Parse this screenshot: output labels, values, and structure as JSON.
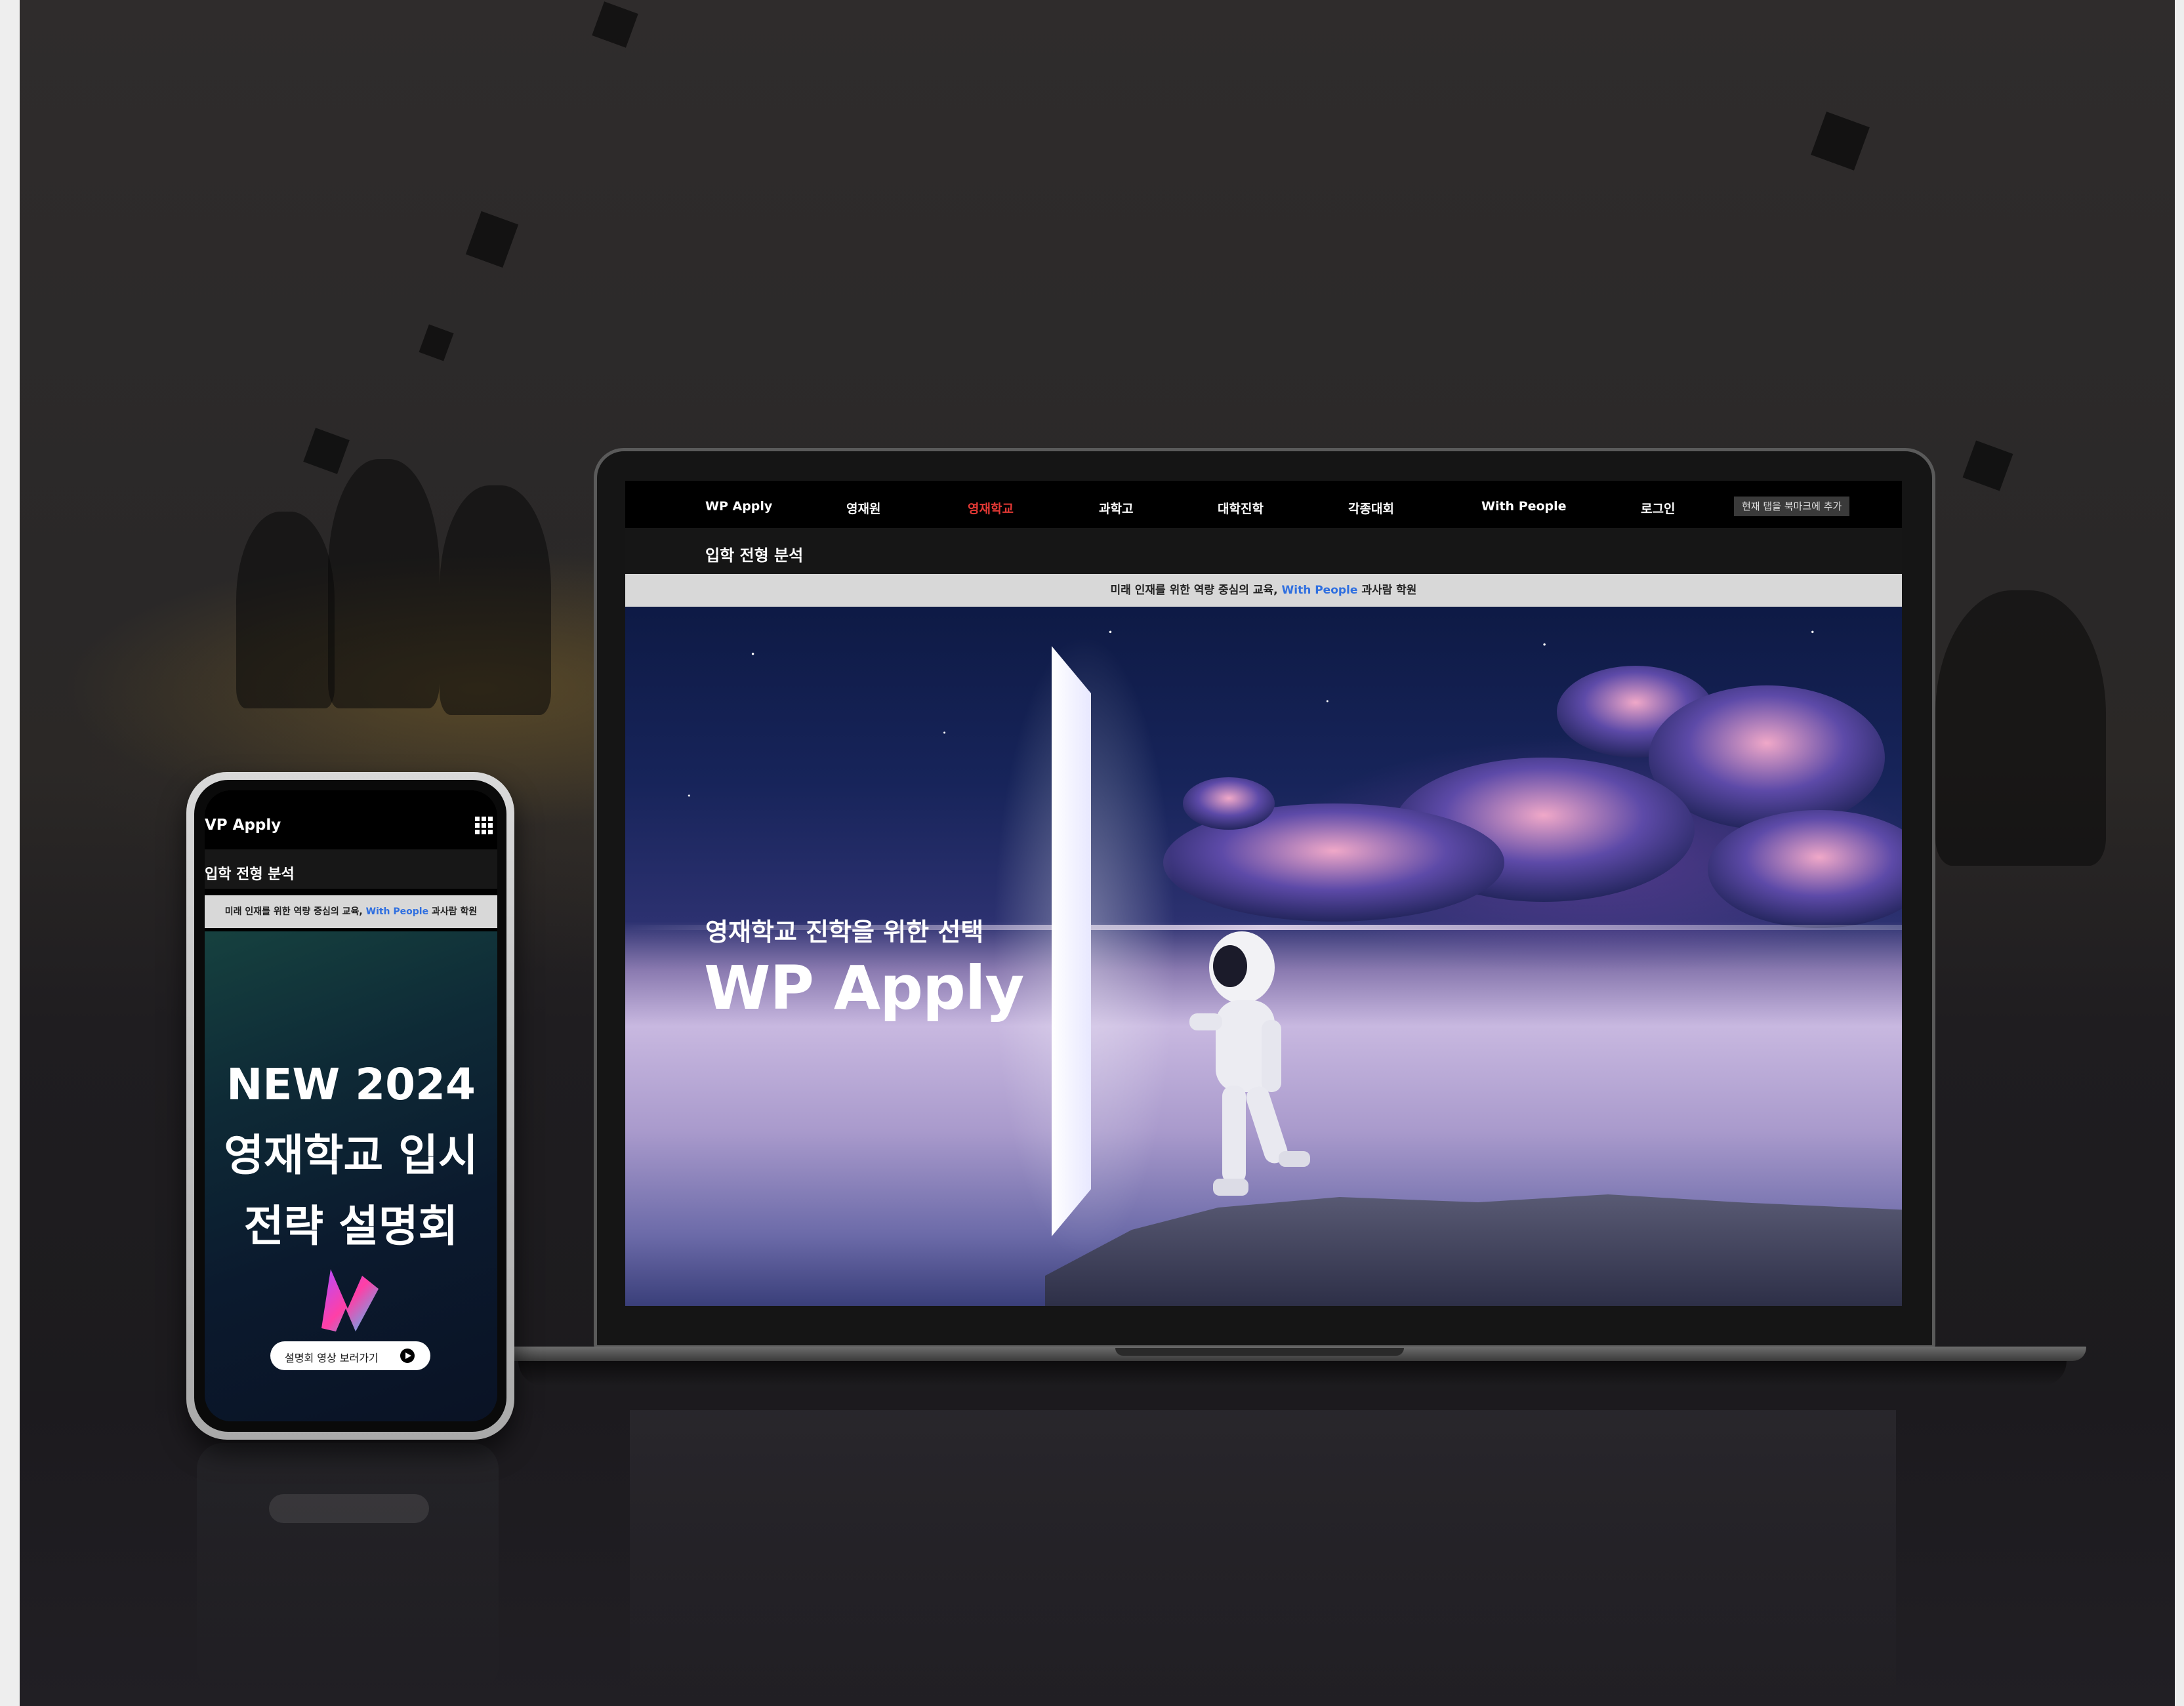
{
  "laptop": {
    "nav": {
      "items": [
        {
          "label": "WP Apply",
          "active": false
        },
        {
          "label": "영재원",
          "active": false
        },
        {
          "label": "영재학교",
          "active": true
        },
        {
          "label": "과학고",
          "active": false
        },
        {
          "label": "대학진학",
          "active": false
        },
        {
          "label": "각종대회",
          "active": false
        },
        {
          "label": "With People",
          "active": false
        },
        {
          "label": "로그인",
          "active": false
        }
      ],
      "bookmark_button": "현재 탭을 북마크에 추가"
    },
    "subnav_title": "입학 전형 분석",
    "banner": {
      "prefix": "미래 인재를 위한 역량 중심의 교육,",
      "highlight": "With People",
      "suffix": "과사람 학원"
    },
    "hero": {
      "subtitle": "영재학교 진학을 위한 선택",
      "title": "WP Apply"
    }
  },
  "phone": {
    "logo": "VP Apply",
    "subnav_title": "입학 전형 분석",
    "banner": {
      "prefix": "미래 인재를 위한 역량 중심의 교육,",
      "highlight": "With People",
      "suffix": "과사람 학원"
    },
    "headline": [
      "NEW 2024",
      "영재학교 입시",
      "전략 설명회"
    ],
    "cta_button": "설명회 영상 보러가기"
  },
  "colors": {
    "accent_active": "#e53935",
    "link_blue": "#2f6fe0",
    "nav_bg": "#000000",
    "banner_bg": "#d8d8d8"
  },
  "icons": [
    "grid-menu-icon",
    "play-icon",
    "brand-logo-icon"
  ]
}
